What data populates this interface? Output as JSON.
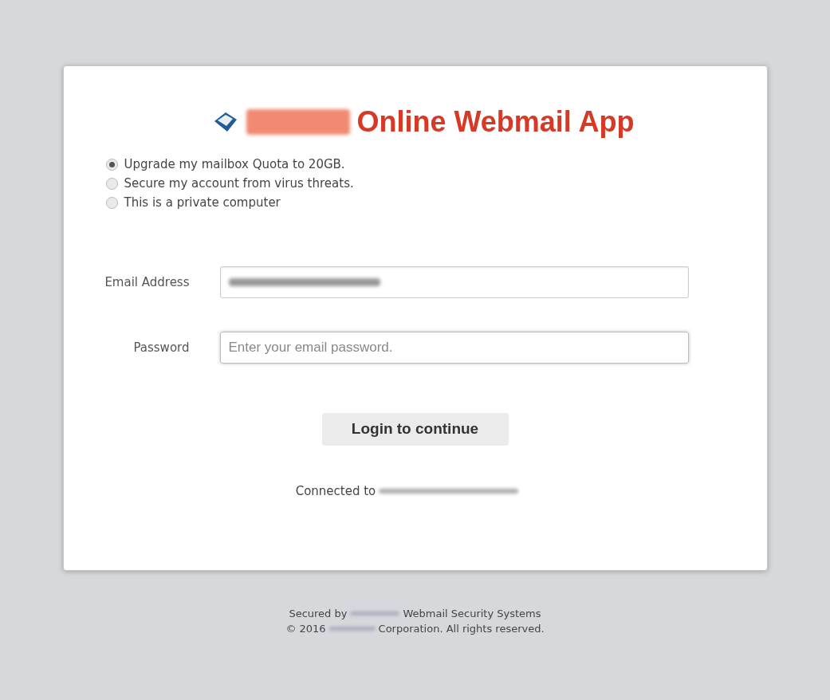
{
  "header": {
    "title": "Online Webmail App"
  },
  "options": [
    {
      "label": "Upgrade my mailbox Quota to 20GB.",
      "selected": true
    },
    {
      "label": "Secure my account from virus threats.",
      "selected": false
    },
    {
      "label": "This is a private computer",
      "selected": false
    }
  ],
  "fields": [
    {
      "label": "Email Address",
      "kind": "redacted"
    },
    {
      "label": "Password",
      "kind": "input",
      "placeholder": "Enter your email password."
    }
  ],
  "button": "Login to continue",
  "connected": "Connected to",
  "footer": {
    "line_1": [
      "Secured by",
      "Webmail Security Systems"
    ],
    "line_2": [
      "© 2016",
      "Corporation. All rights reserved."
    ]
  }
}
